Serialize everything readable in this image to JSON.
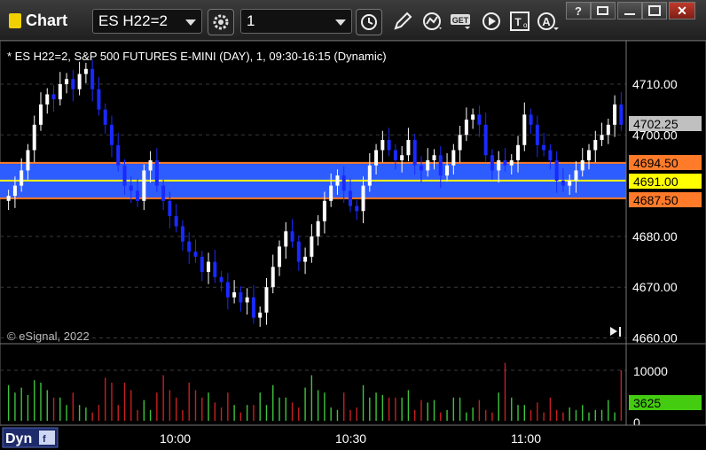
{
  "window": {
    "title": "Chart",
    "symbol": "ES H22=2",
    "interval": "1"
  },
  "chart_info": "* ES H22=2, S&P 500 FUTURES E-MINI (DAY), 1, 09:30-16:15 (Dynamic)",
  "copyright": "© eSignal, 2022",
  "dyn_label": "Dyn",
  "colors": {
    "up": "#ffffff",
    "down": "#1a2aff",
    "zone": "#2d5cff",
    "level_orange": "#ff7b2a",
    "level_yellow": "#ffff00",
    "last_price": "#c0c0c0",
    "vol_up": "#3ec43e",
    "vol_down": "#c82020",
    "vol_tag": "#44cc11"
  },
  "price_axis": {
    "ticks": [
      "4710.00",
      "4700.00",
      "4680.00",
      "4670.00",
      "4660.00"
    ],
    "tick_values": [
      4710,
      4700,
      4680,
      4670,
      4660
    ],
    "range": [
      4658,
      4720
    ]
  },
  "levels": {
    "last": "4702.25",
    "upper": "4694.50",
    "mid": "4691.00",
    "lower": "4687.50"
  },
  "volume_axis": {
    "ticks": [
      "10000",
      "0"
    ],
    "last": "3625"
  },
  "time_axis": {
    "labels": [
      "10:00",
      "10:30",
      "11:00"
    ]
  },
  "chart_data": {
    "type": "candlestick",
    "bar_interval_minutes": 1,
    "price_levels": [
      4694.5,
      4691.0,
      4687.5
    ],
    "closes": [
      4688,
      4690,
      4693,
      4697,
      4702,
      4706,
      4708,
      4707,
      4710,
      4711,
      4709,
      4712,
      4713,
      4709,
      4705,
      4702,
      4698,
      4694,
      4690,
      4689,
      4687,
      4693,
      4695,
      4690,
      4687,
      4684,
      4682,
      4679,
      4677,
      4676,
      4673,
      4675,
      4672,
      4671,
      4668,
      4669,
      4667,
      4668,
      4664,
      4665,
      4670,
      4674,
      4678,
      4681,
      4679,
      4675,
      4676,
      4680,
      4683,
      4687,
      4690,
      4692,
      4689,
      4686,
      4685,
      4690,
      4694,
      4697,
      4699,
      4697,
      4695,
      4696,
      4699,
      4694,
      4693,
      4695,
      4696,
      4692,
      4694,
      4697,
      4700,
      4703,
      4704,
      4702,
      4696,
      4693,
      4695,
      4694,
      4695,
      4698,
      4704,
      4702,
      4698,
      4697,
      4695,
      4691,
      4690,
      4691,
      4693,
      4695,
      4697,
      4699,
      4700,
      4702,
      4706,
      4702
    ],
    "volume": [
      7000,
      5500,
      6500,
      5000,
      8000,
      7500,
      6000,
      4500,
      4500,
      3000,
      5500,
      3000,
      2500,
      1500,
      3000,
      8500,
      7500,
      3000,
      7500,
      6000,
      2000,
      4000,
      2000,
      5500,
      9000,
      6000,
      4500,
      2000,
      7500,
      6000,
      4500,
      5500,
      3500,
      2500,
      5500,
      3000,
      1500,
      3000,
      3000,
      5500,
      3000,
      7000,
      4500,
      4500,
      3500,
      2500,
      6500,
      9000,
      6000,
      5500,
      2500,
      2000,
      5500,
      2000,
      2500,
      7000,
      4500,
      5500,
      5000,
      4500,
      4500,
      4500,
      6000,
      2000,
      4000,
      3500,
      4000,
      1500,
      2000,
      4500,
      4500,
      1500,
      2500,
      4000,
      2000,
      1500,
      5500,
      11500,
      4500,
      3000,
      3000,
      2000,
      3500,
      1500,
      4500,
      2000,
      1500,
      2500,
      2000,
      3000,
      1500,
      2000,
      2000,
      4000,
      1500,
      10000
    ]
  }
}
